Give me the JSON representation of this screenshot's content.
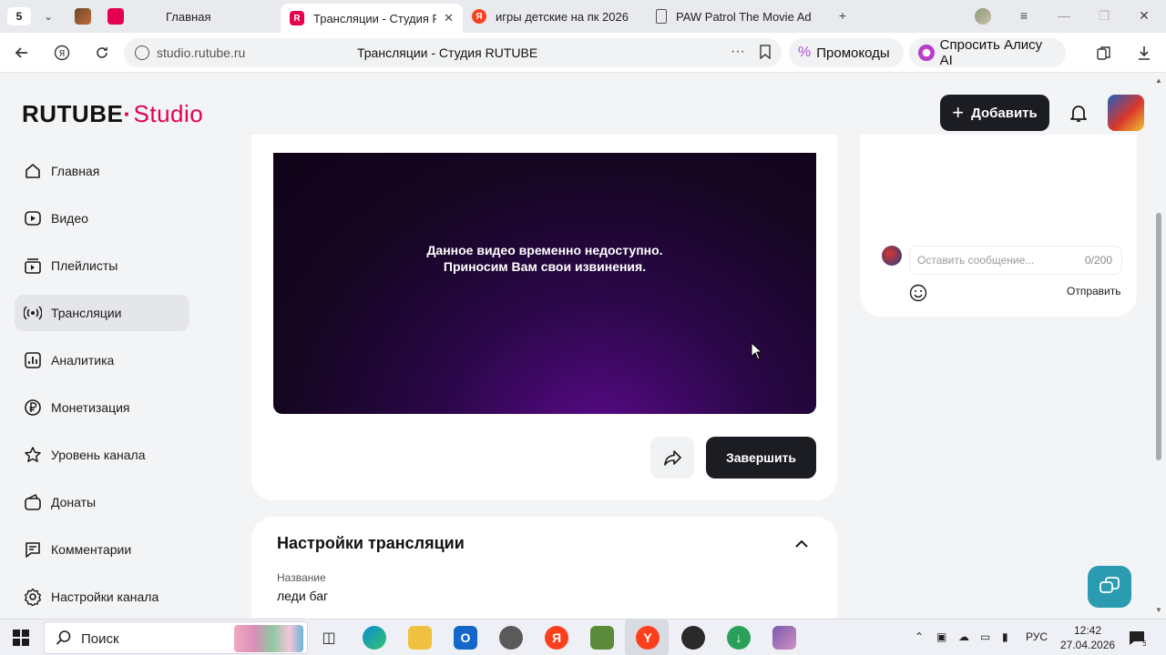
{
  "browser": {
    "tab_count": "5",
    "tabs": [
      {
        "label": "Главная"
      },
      {
        "label": "Трансляции - Студия R"
      },
      {
        "label": "игры детские на пк 2026"
      },
      {
        "label": "PAW Patrol The Movie Adv"
      }
    ],
    "url_domain": "studio.rutube.ru",
    "page_title": "Трансляции - Студия RUTUBE",
    "promo_label": "Промокоды",
    "alice_label": "Спросить Алису AI"
  },
  "header": {
    "logo_text": "RUTUBE",
    "logo_suffix": "Studio",
    "add_button": "Добавить"
  },
  "sidebar": {
    "items": [
      {
        "label": "Главная",
        "icon": "home-icon"
      },
      {
        "label": "Видео",
        "icon": "video-icon"
      },
      {
        "label": "Плейлисты",
        "icon": "playlist-icon"
      },
      {
        "label": "Трансляции",
        "icon": "broadcast-icon",
        "active": true
      },
      {
        "label": "Аналитика",
        "icon": "analytics-icon"
      },
      {
        "label": "Монетизация",
        "icon": "ruble-icon"
      },
      {
        "label": "Уровень канала",
        "icon": "star-icon"
      },
      {
        "label": "Донаты",
        "icon": "wallet-icon"
      },
      {
        "label": "Комментарии",
        "icon": "comment-icon"
      },
      {
        "label": "Настройки канала",
        "icon": "gear-icon"
      }
    ]
  },
  "player": {
    "message_line1": "Данное видео временно недоступно.",
    "message_line2": "Приносим Вам свои извинения."
  },
  "actions": {
    "finish_button": "Завершить"
  },
  "settings": {
    "title": "Настройки трансляции",
    "name_label": "Название",
    "name_value": "леди баг"
  },
  "chat": {
    "placeholder": "Оставить сообщение...",
    "counter": "0/200",
    "send_label": "Отправить"
  },
  "taskbar": {
    "search_label": "Поиск",
    "language": "РУС",
    "time": "12:42",
    "date": "27.04.2026",
    "notification_count": "5"
  },
  "colors": {
    "brand": "#e4004f",
    "dark_button": "#1c1d22",
    "help_button": "#2a9bb0"
  }
}
